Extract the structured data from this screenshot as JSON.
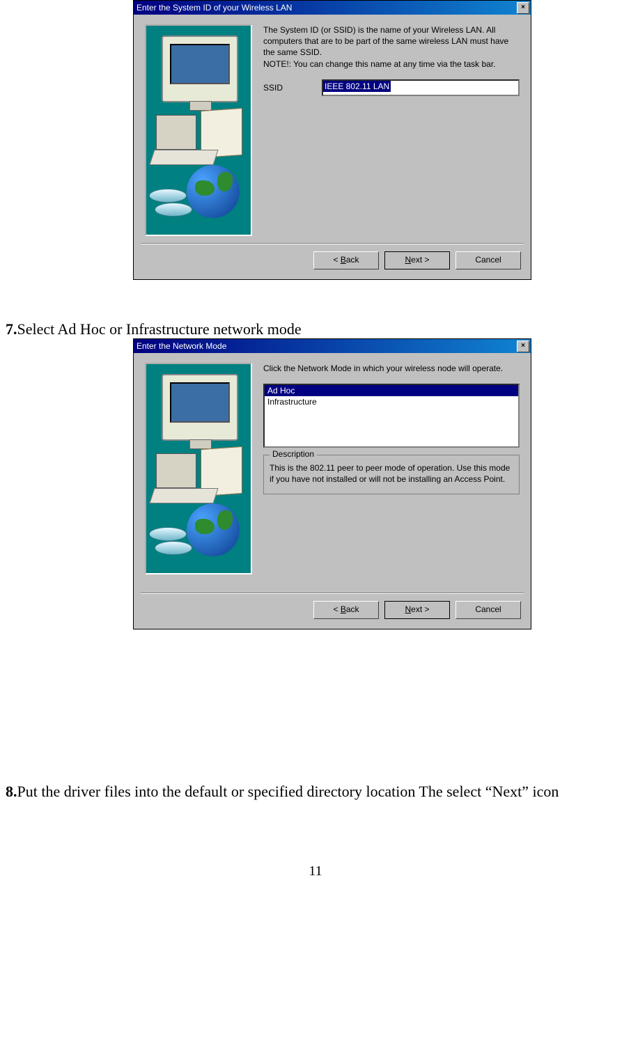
{
  "page_number": "11",
  "dialog1": {
    "title": "Enter the System ID of your Wireless LAN",
    "instruction": "The System ID (or SSID) is the name of your Wireless LAN.  All computers that are to be part of the same wireless LAN must have the same SSID.\nNOTE!: You can change this name at any time via the task bar.",
    "ssid_label": "SSID",
    "ssid_value": "IEEE 802.11 LAN",
    "buttons": {
      "back": "< Back",
      "next": "Next >",
      "cancel": "Cancel"
    }
  },
  "step7": {
    "num": "7.",
    "text": "Select Ad Hoc or Infrastructure network mode"
  },
  "dialog2": {
    "title": "Enter the Network Mode",
    "instruction": "Click the Network Mode in which your wireless node will operate.",
    "options": [
      "Ad Hoc",
      "Infrastructure"
    ],
    "selected_index": 0,
    "description_label": "Description",
    "description_text": "This is the 802.11 peer to peer mode of operation.  Use this mode if you have not installed or will not be  installing an Access Point.",
    "buttons": {
      "back": "< Back",
      "next": "Next >",
      "cancel": "Cancel"
    }
  },
  "step8": {
    "num": "8.",
    "text": "Put the driver files into the default or specified directory location The select “Next” icon"
  }
}
